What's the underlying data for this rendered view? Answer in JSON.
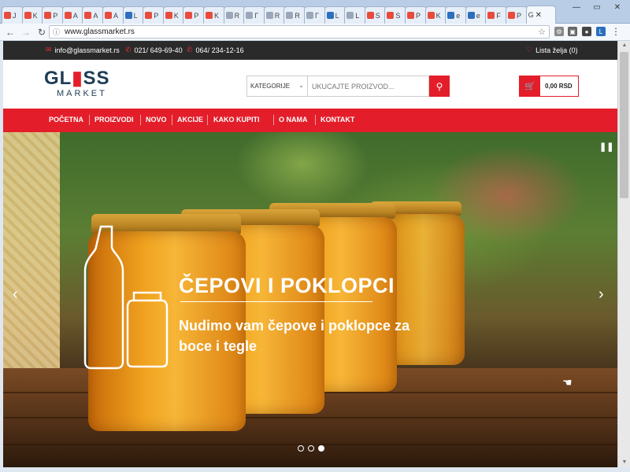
{
  "browser": {
    "tabs": [
      {
        "label": "J",
        "color": "#e84b3c"
      },
      {
        "label": "K",
        "color": "#e84b3c"
      },
      {
        "label": "P",
        "color": "#e84b3c"
      },
      {
        "label": "A",
        "color": "#e84b3c"
      },
      {
        "label": "A",
        "color": "#e84b3c"
      },
      {
        "label": "A",
        "color": "#e84b3c"
      },
      {
        "label": "L",
        "color": "#2c6fbd"
      },
      {
        "label": "P",
        "color": "#e84b3c"
      },
      {
        "label": "K",
        "color": "#e84b3c"
      },
      {
        "label": "P",
        "color": "#e84b3c"
      },
      {
        "label": "K",
        "color": "#e84b3c"
      },
      {
        "label": "R",
        "color": "#9aa7b8"
      },
      {
        "label": "Γ",
        "color": "#9aa7b8"
      },
      {
        "label": "R",
        "color": "#9aa7b8"
      },
      {
        "label": "R",
        "color": "#9aa7b8"
      },
      {
        "label": "Γ",
        "color": "#9aa7b8"
      },
      {
        "label": "L",
        "color": "#2c6fbd"
      },
      {
        "label": "L",
        "color": "#9aa7b8"
      },
      {
        "label": "S",
        "color": "#e84b3c"
      },
      {
        "label": "S",
        "color": "#e84b3c"
      },
      {
        "label": "P",
        "color": "#e84b3c"
      },
      {
        "label": "K",
        "color": "#e84b3c"
      },
      {
        "label": "e",
        "color": "#2c6fbd"
      },
      {
        "label": "e",
        "color": "#2c6fbd"
      },
      {
        "label": "F",
        "color": "#e84b3c"
      },
      {
        "label": "P",
        "color": "#e84b3c"
      }
    ],
    "active_tab": {
      "label": "G",
      "close": "✕"
    },
    "url": "www.glassmarket.rs",
    "star": "☆"
  },
  "topbar": {
    "email": "info@glassmarket.rs",
    "phone1": "021/ 649-69-40",
    "phone2": "064/ 234-12-16",
    "wishlist": "Lista želja (0)"
  },
  "logo": {
    "part1": "GL",
    "part2": "SS",
    "market": "MARKET"
  },
  "search": {
    "category": "KATEGORIJE",
    "placeholder": "UKUCAJTE PROIZVOD..."
  },
  "cart": {
    "total": "0,00 RSD"
  },
  "nav": {
    "items": [
      "POČETNA",
      "PROIZVODI",
      "NOVO",
      "AKCIJE",
      "KAKO KUPITI",
      "O NAMA",
      "KONTAKT"
    ]
  },
  "hero": {
    "title": "ČEPOVI I POKLOPCI",
    "subtitle": "Nudimo vam čepove i poklopce za boce i tegle",
    "slides": 3,
    "active_slide": 3
  },
  "colors": {
    "brand_red": "#e31e2a",
    "brand_navy": "#1f3c55",
    "topbar_bg": "#2a2a2a"
  }
}
